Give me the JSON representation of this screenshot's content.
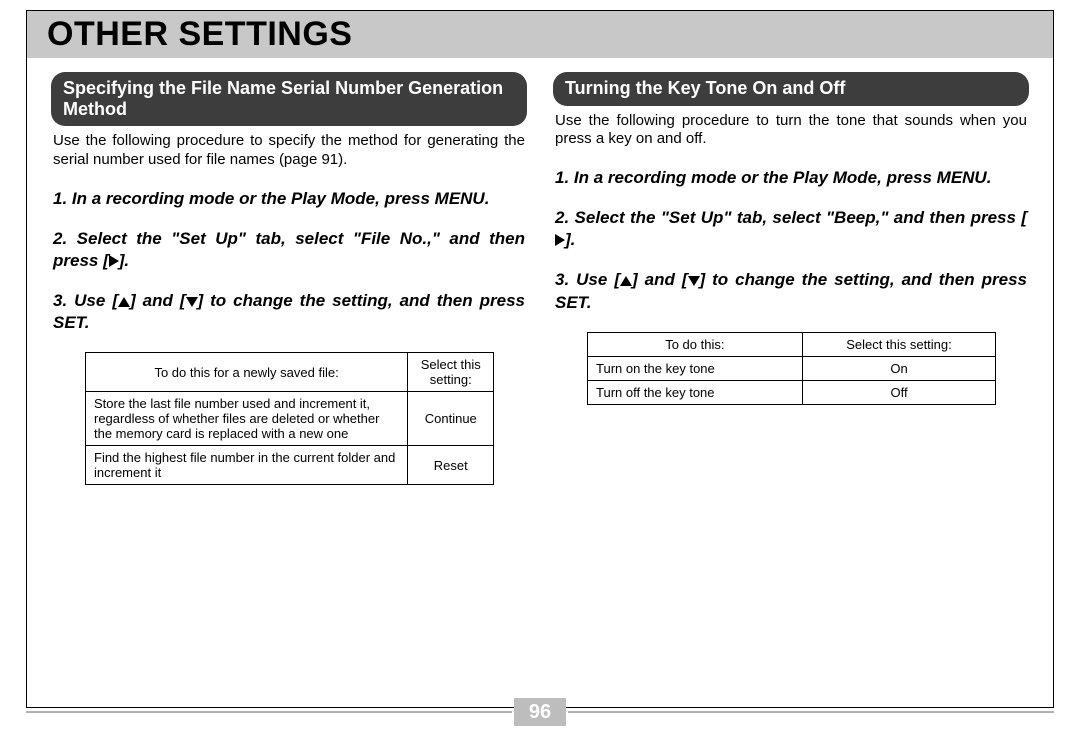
{
  "title": "OTHER SETTINGS",
  "page_number": "96",
  "left": {
    "heading": "Specifying the File Name Serial Number Generation Method",
    "intro": "Use the following procedure to specify the method for generating the serial number used for file names (page 91).",
    "step1_pre": "1.  In a recording mode or the Play Mode, press MENU.",
    "step2_a": "2.  Select the \"Set Up\" tab, select \"File No.,\" and then press [",
    "step2_b": "].",
    "step3_a": "3.  Use [",
    "step3_b": "] and [",
    "step3_c": "] to change the setting, and then press SET.",
    "th1": "To do this for a newly saved file:",
    "th2": "Select this setting:",
    "rows": [
      {
        "desc": "Store the last file number used and increment it, regardless of whether files are deleted or whether the memory card is replaced with a new one",
        "setting": "Continue"
      },
      {
        "desc": "Find the highest file number in the current folder and increment it",
        "setting": "Reset"
      }
    ]
  },
  "right": {
    "heading": "Turning the Key Tone On and Off",
    "intro": "Use the following procedure to turn the tone that sounds when you press a key on and off.",
    "step1_pre": "1.  In a recording mode or the Play Mode, press MENU.",
    "step2_a": "2.  Select the \"Set Up\" tab, select \"Beep,\" and then press [",
    "step2_b": "].",
    "step3_a": "3.  Use [",
    "step3_b": "] and [",
    "step3_c": "] to change the setting, and then press SET.",
    "th1": "To do this:",
    "th2": "Select this setting:",
    "rows": [
      {
        "desc": "Turn on the key tone",
        "setting": "On"
      },
      {
        "desc": "Turn off the key tone",
        "setting": "Off"
      }
    ]
  }
}
